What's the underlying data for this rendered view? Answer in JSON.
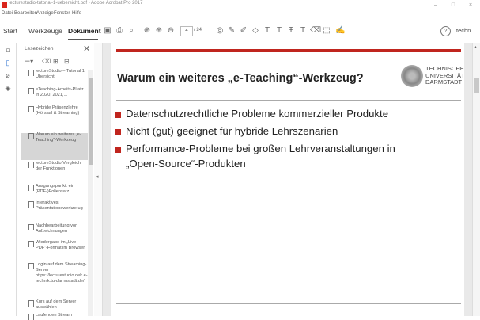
{
  "window": {
    "title": "lecturestudio-tutorial-1-uebersicht.pdf - Adobe Acrobat Pro 2017",
    "controls": [
      "–",
      "□",
      "×"
    ]
  },
  "menu": [
    "Datei",
    "Bearbeiten",
    "Anzeige",
    "Fenster",
    "Hilfe"
  ],
  "tabs": [
    "Start",
    "Werkzeuge",
    "Dokument"
  ],
  "page_nav": {
    "current": "4",
    "total": "/ 24"
  },
  "help": "?",
  "user": "techn.",
  "bookmarks_panel": {
    "label": "Lesezeichen",
    "items": [
      "lectureStudio – Tutorial 1: Übersicht",
      "eTeaching-Arbeits-Pl atz in 2020, 2021,...",
      "Hybride Präsenzlehre (Hörsaal & Streaming)",
      "Warum ein weiteres „e-Teaching“-Werkzeug",
      "lectureStudio Vergleich der Funktionen",
      "Ausgangspunkt: ein (PDF-)Foliensatz",
      "Interaktives Präsentationswerkze ug",
      "Nachbearbeitung von Aufzeichnungen",
      "Wiedergabe im „Live-PDF“-Format im Browser",
      "Login auf dem Streaming-Server https://lecturestudio.dek.e-technik.tu-dar mstadt.de/",
      "Kurs auf dem Server auswählen",
      "Laufenden Stream"
    ]
  },
  "slide": {
    "title": "Warum ein weiteres „e-Teaching“-Werkzeug?",
    "university": [
      "TECHNISCHE",
      "UNIVERSITÄT",
      "DARMSTADT"
    ],
    "bullets": [
      "Datenschutzrechtliche Probleme kommerzieller Produkte",
      "Nicht (gut) geeignet für hybride Lehrszenarien",
      "Performance-Probleme bei großen Lehrveranstaltungen in",
      "„Open-Source“-Produkten"
    ]
  },
  "colors": {
    "accent_red": "#c0251e"
  }
}
